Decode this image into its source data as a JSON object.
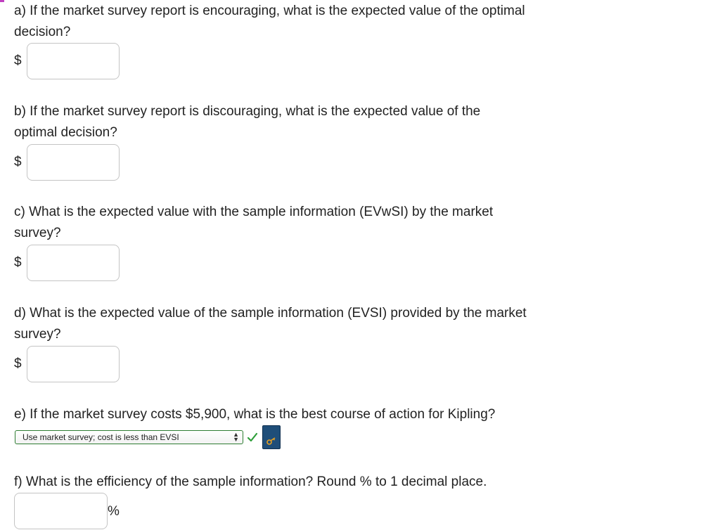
{
  "questions": {
    "a": {
      "text_line1": "a) If the market survey report is encouraging, what is the expected value of the optimal",
      "text_line2": "decision?",
      "currency": "$",
      "value": ""
    },
    "b": {
      "text_line1": "b) If the market survey report is discouraging, what is the expected value of the",
      "text_line2": "optimal decision?",
      "currency": "$",
      "value": ""
    },
    "c": {
      "text_line1": "c) What is the expected value with the sample information (EVwSI) by the market",
      "text_line2": "survey?",
      "currency": "$",
      "value": ""
    },
    "d": {
      "text_line1": "d) What is the expected value of the sample information (EVSI) provided by the market",
      "text_line2": "survey?",
      "currency": "$",
      "value": ""
    },
    "e": {
      "text": "e) If the market survey costs $5,900, what is the best course of action for Kipling?",
      "selected_option": "Use market survey; cost is less than EVSI",
      "status_icon": "check-icon",
      "key_icon": "key-icon"
    },
    "f": {
      "text": "f) What is the efficiency of the sample information? Round % to 1 decimal place.",
      "value": "",
      "unit": "%"
    }
  },
  "colors": {
    "text": "#222222",
    "input_border": "#c4c4c4",
    "select_border_correct": "#2e7d32",
    "check": "#2e9e3a",
    "key_button": "#1f4e79"
  }
}
